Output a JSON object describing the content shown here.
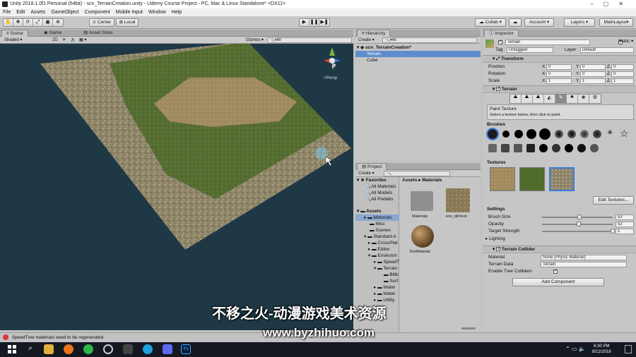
{
  "window": {
    "title": "Unity 2018.1.0f1 Personal (64bit) - scn_TerrainCreation.unity - Udemy Course Project - PC, Mac & Linux Standalone* <DX11>"
  },
  "menu": [
    "File",
    "Edit",
    "Assets",
    "GameObject",
    "Component",
    "Mobile Input",
    "Window",
    "Help"
  ],
  "toolbar": {
    "center": "Center",
    "local": "Local",
    "collab": "Collab ▾",
    "account": "Account",
    "layers": "Layers",
    "layout": "MainLayou▾"
  },
  "scene": {
    "tabs": [
      "Scene",
      "Game",
      "Asset Store"
    ],
    "shading": "Shaded",
    "mode2d": "2D",
    "gizmos": "Gizmos ▾",
    "search": "All",
    "persp": "<Persp"
  },
  "hierarchy": {
    "tab": "Hierarchy",
    "create": "Create ▾",
    "search": "All",
    "scene": "scn_TerrainCreation*",
    "items": [
      "Terrain",
      "Cube"
    ]
  },
  "project": {
    "tab": "Project",
    "create": "Create ▾",
    "breadcrumb": "Assets ▸ Materials",
    "favorites": {
      "label": "Favorites",
      "items": [
        "All Materials",
        "All Models",
        "All Prefabs"
      ]
    },
    "tree": [
      "Assets",
      "Materials",
      "Misc",
      "Scenes",
      "Standard A",
      "CrossPlat",
      "Editor",
      "Environm",
      "SpeedT",
      "Terrain",
      "Billb",
      "Surf",
      "Water",
      "Water",
      "Utility"
    ],
    "assets": [
      "Materials",
      "env_dirtrock",
      "TextMaterial"
    ]
  },
  "inspector": {
    "tab": "Inspector",
    "name": "Terrain",
    "static": "Static ▾",
    "tag_label": "Tag",
    "tag": "Untagged",
    "layer_label": "Layer",
    "layer": "Default",
    "transform": {
      "title": "Transform",
      "rows": [
        {
          "label": "Position",
          "x": "0",
          "y": "0",
          "z": "0"
        },
        {
          "label": "Rotation",
          "x": "0",
          "y": "0",
          "z": "0"
        },
        {
          "label": "Scale",
          "x": "1",
          "y": "1",
          "z": "1"
        }
      ]
    },
    "terrain": {
      "title": "Terrain",
      "paint_title": "Paint Texture",
      "paint_hint": "Select a texture below, then click to paint.",
      "brushes": "Brushes",
      "textures": "Textures",
      "edit_textures": "Edit Textures...",
      "settings": "Settings",
      "brush_size_label": "Brush Size",
      "brush_size": "53",
      "brush_size_frac": 0.53,
      "opacity_label": "Opacity",
      "opacity": "52",
      "opacity_frac": 0.52,
      "strength_label": "Target Strength",
      "strength": "1",
      "strength_frac": 1.0,
      "lighting": "Lighting"
    },
    "collider": {
      "title": "Terrain Collider",
      "material_label": "Material",
      "material": "None (Physic Material)",
      "data_label": "Terrain Data",
      "data": "Terrain",
      "trees_label": "Enable Tree Colliders"
    },
    "add_component": "Add Component"
  },
  "status": "SpeedTree materials need to be regenerated.",
  "taskbar": {
    "time": "6:30 PM",
    "date": "8/12/2018"
  },
  "watermark": {
    "line1": "不移之火-动漫游戏美术资源",
    "line2": "www.byzhihuo.com"
  }
}
